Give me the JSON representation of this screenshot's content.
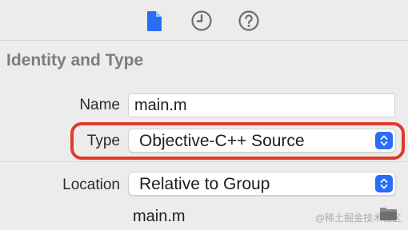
{
  "inspector_tabs": {
    "file": {
      "icon": "file-doc-icon",
      "selected": true
    },
    "history": {
      "icon": "clock-icon",
      "selected": false
    },
    "help": {
      "icon": "question-icon",
      "selected": false
    }
  },
  "identity": {
    "section_title": "Identity and Type",
    "name_label": "Name",
    "name_value": "main.m",
    "type_label": "Type",
    "type_value": "Objective-C++ Source",
    "location_label": "Location",
    "location_value": "Relative to Group",
    "path_value": "main.m"
  },
  "watermark": "@稀土掘金技术社区",
  "colors": {
    "accent": "#2a6df6",
    "highlight": "#e03a2a"
  }
}
